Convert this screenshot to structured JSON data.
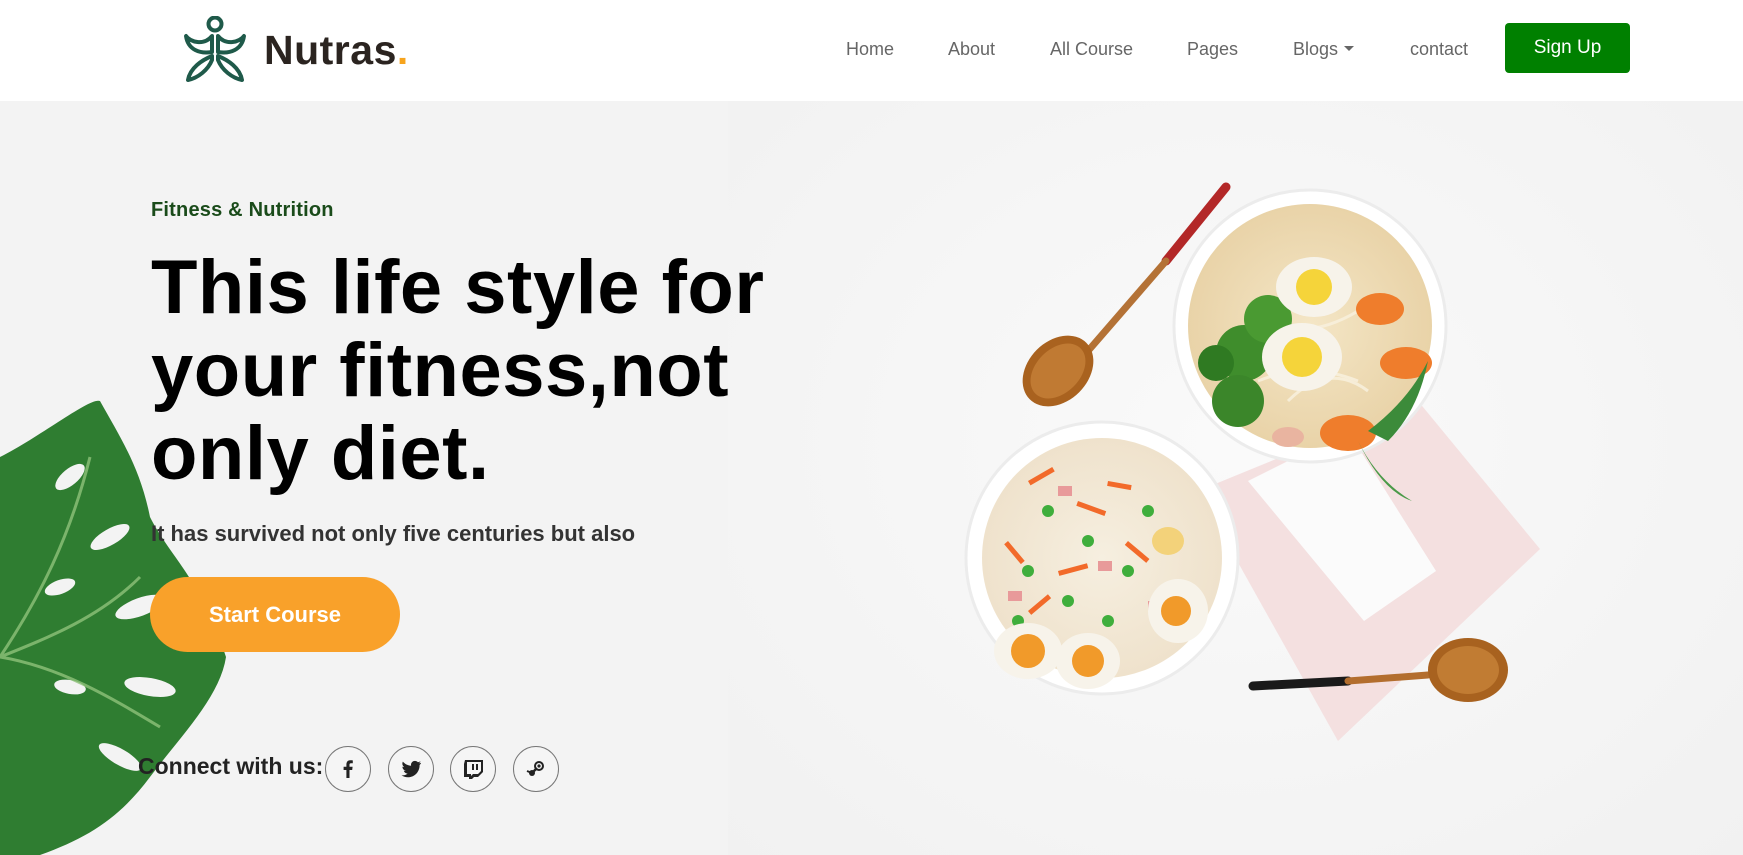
{
  "brand": {
    "name": "Nutras",
    "dot": "."
  },
  "nav": {
    "items": [
      {
        "label": "Home"
      },
      {
        "label": "About"
      },
      {
        "label": "All Course"
      },
      {
        "label": "Pages"
      },
      {
        "label": "Blogs",
        "has_dropdown": true
      },
      {
        "label": "contact"
      }
    ],
    "signup_label": "Sign Up"
  },
  "hero": {
    "kicker": "Fitness & Nutrition",
    "headline": [
      "This life style for",
      "your fitness,not",
      "only diet."
    ],
    "subtext": "It has survived not only five centuries but also",
    "cta_label": "Start Course",
    "connect_label": "Connect with us:",
    "socials": [
      "facebook-icon",
      "twitter-icon",
      "twitch-icon",
      "steam-icon"
    ]
  },
  "colors": {
    "accent_green": "#008000",
    "kicker_green": "#1a4b1a",
    "cta_orange": "#f9a12a",
    "brand_dot": "#f7a41d",
    "logo_teal": "#1f5a4a"
  }
}
